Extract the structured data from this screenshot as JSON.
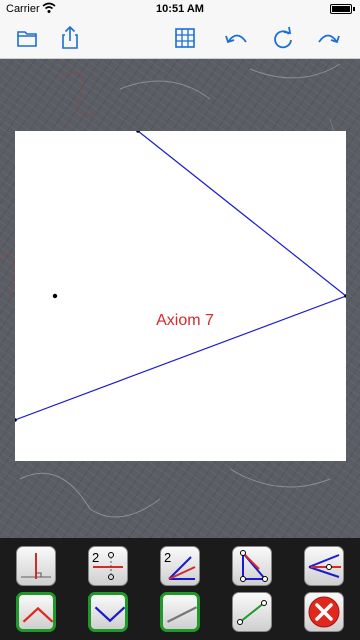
{
  "status_bar": {
    "carrier": "Carrier",
    "time": "10:51 AM",
    "battery_level": 1.0
  },
  "toolbar": {
    "open_icon": "folder-icon",
    "share_icon": "share-icon",
    "grid_icon": "grid-icon",
    "undo_icon": "undo-icon",
    "reset_icon": "refresh-icon",
    "redo_icon": "redo-icon",
    "accent_color": "#1a6fd6"
  },
  "canvas": {
    "background_color": "#5a5e64",
    "paper_color": "#ffffff",
    "label": "Axiom 7",
    "label_color": "#d42a2a",
    "fold_line_color": "#1a1ad0"
  },
  "palette": {
    "row1": [
      {
        "name": "axiom-perpendicular-tool",
        "icon": "perpendicular-fold-icon"
      },
      {
        "name": "axiom-point-to-point-tool",
        "icon": "point-to-line-2-icon"
      },
      {
        "name": "axiom-angle-bisector-tool",
        "icon": "angle-bisector-2-icon"
      },
      {
        "name": "axiom-triangle-tool",
        "icon": "triangle-fold-icon"
      },
      {
        "name": "axiom-angle-tool",
        "icon": "angle-fold-icon"
      }
    ],
    "row2": [
      {
        "name": "valley-fold-tool",
        "icon": "valley-fold-icon",
        "selected": true
      },
      {
        "name": "mountain-fold-tool",
        "icon": "mountain-fold-icon",
        "selected": true
      },
      {
        "name": "line-tool",
        "icon": "line-icon",
        "selected": true
      },
      {
        "name": "segment-tool",
        "icon": "segment-icon",
        "selected": false
      },
      {
        "name": "delete-tool",
        "icon": "delete-icon",
        "selected": false
      }
    ],
    "selected_border_color": "#1f9a2a",
    "delete_color": "#e0281e"
  }
}
